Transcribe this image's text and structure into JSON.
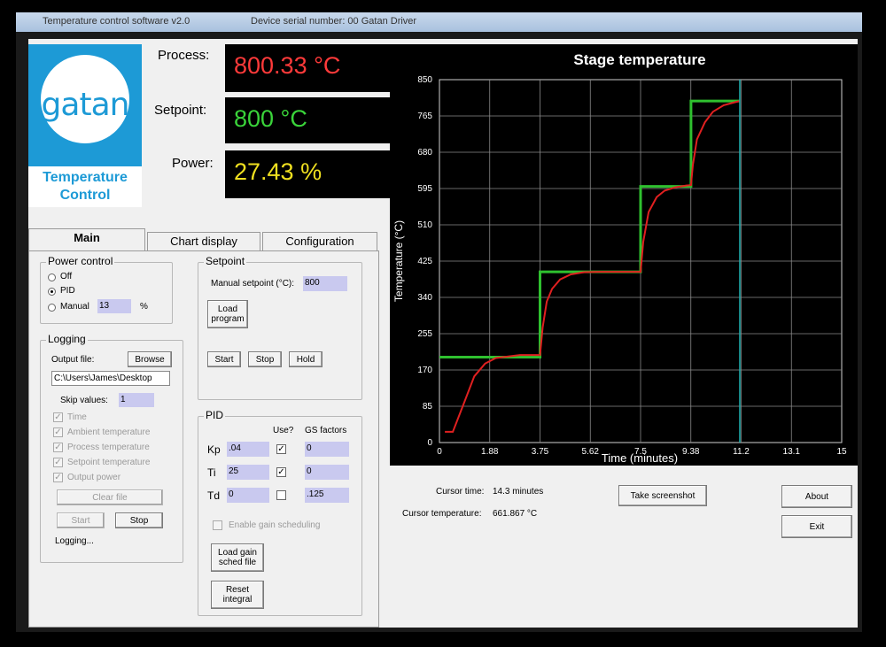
{
  "window": {
    "title": "Temperature control software v2.0",
    "subtitle": "Device serial number: 00 Gatan Driver"
  },
  "logo": {
    "brand": "gatan",
    "product_line1": "Temperature",
    "product_line2": "Control"
  },
  "readouts": {
    "process_label": "Process:",
    "process_value": "800.33 °C",
    "setpoint_label": "Setpoint:",
    "setpoint_value": "800 °C",
    "power_label": "Power:",
    "power_value": "27.43 %"
  },
  "tabs": [
    "Main",
    "Chart display",
    "Configuration"
  ],
  "power_control": {
    "title": "Power control",
    "off_label": "Off",
    "pid_label": "PID",
    "manual_label": "Manual",
    "manual_value": "13",
    "manual_unit": "%",
    "selected": "PID"
  },
  "logging": {
    "title": "Logging",
    "output_file_label": "Output file:",
    "browse_label": "Browse",
    "path": "C:\\Users\\James\\Desktop",
    "skip_values_label": "Skip values:",
    "skip_values": "1",
    "fields": [
      "Time",
      "Ambient temperature",
      "Process temperature",
      "Setpoint temperature",
      "Output power"
    ],
    "clear_file_label": "Clear file",
    "start_label": "Start",
    "stop_label": "Stop",
    "status": "Logging..."
  },
  "setpoint": {
    "title": "Setpoint",
    "manual_label": "Manual setpoint (°C):",
    "manual_value": "800",
    "load_program_line1": "Load",
    "load_program_line2": "program",
    "start_label": "Start",
    "stop_label": "Stop",
    "hold_label": "Hold"
  },
  "pid": {
    "title": "PID",
    "use_header": "Use?",
    "gs_header": "GS factors",
    "rows": [
      {
        "label": "Kp",
        "value": ".04",
        "use": true,
        "gs": "0"
      },
      {
        "label": "Ti",
        "value": "25",
        "use": true,
        "gs": "0"
      },
      {
        "label": "Td",
        "value": "0",
        "use": false,
        "gs": ".125"
      }
    ],
    "enable_gs_label": "Enable gain scheduling",
    "load_gs_line1": "Load gain",
    "load_gs_line2": "sched file",
    "reset_line1": "Reset",
    "reset_line2": "integral"
  },
  "chart_data": {
    "type": "line",
    "title": "Stage temperature",
    "xlabel": "Time (minutes)",
    "ylabel": "Temperature (°C)",
    "xlim": [
      0,
      15
    ],
    "ylim": [
      0,
      850
    ],
    "x_ticks": [
      "0",
      "1.88",
      "3.75",
      "5.62",
      "7.5",
      "9.38",
      "11.2",
      "13.1",
      "15"
    ],
    "y_ticks": [
      "0",
      "85",
      "170",
      "255",
      "340",
      "425",
      "510",
      "595",
      "680",
      "765",
      "850"
    ],
    "grid": true,
    "cursor_x": 11.2,
    "colors": {
      "setpoint": "#2fc02f",
      "process": "#e02020",
      "cursor": "#20b0b0",
      "grid": "#8a8a8a"
    },
    "series": [
      {
        "x": [
          0,
          3.75,
          3.75,
          7.5,
          7.5,
          9.38,
          9.38,
          11.2
        ],
        "y": [
          200,
          200,
          400,
          400,
          600,
          600,
          800,
          800
        ]
      },
      {
        "x": [
          0.2,
          0.5,
          0.9,
          1.3,
          1.7,
          2.1,
          2.6,
          3.0,
          3.4,
          3.75,
          3.85,
          4.0,
          4.2,
          4.5,
          4.9,
          5.4,
          6.0,
          6.6,
          7.1,
          7.5,
          7.6,
          7.8,
          8.1,
          8.4,
          8.8,
          9.2,
          9.38,
          9.45,
          9.6,
          9.9,
          10.2,
          10.6,
          11.0,
          11.2
        ],
        "y": [
          25,
          25,
          90,
          155,
          185,
          198,
          202,
          205,
          205,
          205,
          270,
          330,
          360,
          382,
          394,
          399,
          400,
          400,
          400,
          400,
          470,
          540,
          575,
          590,
          598,
          602,
          603,
          650,
          710,
          750,
          775,
          790,
          797,
          800
        ]
      }
    ]
  },
  "cursor": {
    "time_label": "Cursor time:",
    "time_value": "14.3 minutes",
    "temp_label": "Cursor temperature:",
    "temp_value": "661.867 °C"
  },
  "buttons": {
    "screenshot": "Take screenshot",
    "about": "About",
    "exit": "Exit"
  }
}
